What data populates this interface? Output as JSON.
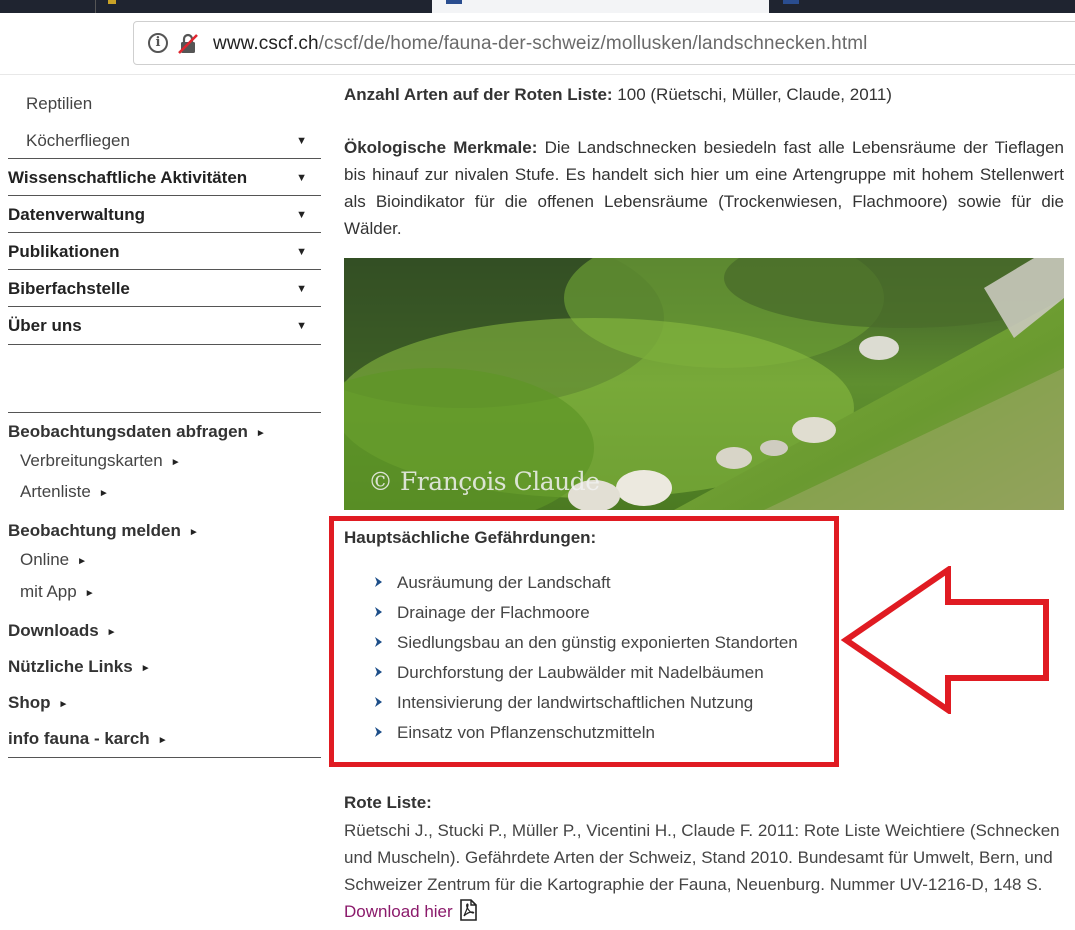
{
  "browser": {
    "url_host": "www.cscf.ch",
    "url_path": "/cscf/de/home/fauna-der-schweiz/mollusken/landschnecken.html"
  },
  "sidebar": {
    "sub_items": [
      {
        "label": "Reptilien"
      },
      {
        "label": "Köcherfliegen"
      }
    ],
    "main_items": [
      {
        "label": "Wissenschaftliche Aktivitäten"
      },
      {
        "label": "Datenverwaltung"
      },
      {
        "label": "Publikationen"
      },
      {
        "label": "Biberfachstelle"
      },
      {
        "label": "Über uns"
      }
    ],
    "caret_symbol": "▼",
    "links": [
      {
        "label": "Beobachtungsdaten abfragen"
      },
      {
        "label": "Verbreitungskarten"
      },
      {
        "label": "Artenliste"
      },
      {
        "label": "Beobachtung melden"
      },
      {
        "label": "Online"
      },
      {
        "label": "mit App"
      },
      {
        "label": "Downloads"
      },
      {
        "label": "Nützliche Links"
      },
      {
        "label": "Shop"
      },
      {
        "label": "info fauna - karch"
      }
    ],
    "arrow_symbol": "►"
  },
  "content": {
    "red_list_count_label": "Anzahl Arten auf der Roten Liste:",
    "red_list_count_value": "100 (Rüetschi, Müller, Claude, 2011)",
    "eco_label": "Ökologische Merkmale:",
    "eco_text": "Die Landschnecken besiedeln fast alle Lebensräume der Tieflagen bis hinauf zur nivalen Stufe. Es handelt sich hier um eine Artengruppe mit hohem Stellenwert als Bioindikator für die offenen Lebensräume (Trockenwiesen, Flachmoore) sowie für die Wälder.",
    "photo_credit": "© François Claude",
    "threats_title": "Hauptsächliche Gefährdungen:",
    "threats": [
      "Ausräumung der Landschaft",
      "Drainage der Flachmoore",
      "Siedlungsbau an den günstig exponierten Standorten",
      "Durchforstung der Laubwälder mit Nadelbäumen",
      "Intensivierung der landwirtschaftlichen Nutzung",
      "Einsatz von Pflanzenschutzmitteln"
    ],
    "rote_liste_title": "Rote Liste:",
    "rote_liste_text": "Rüetschi J., Stucki P., Müller P., Vicentini H., Claude F. 2011: Rote Liste Weichtiere (Schnecken und Muscheln). Gefährdete Arten der Schweiz, Stand 2010. Bundesamt für Umwelt, Bern, und Schweizer Zentrum für die Kartographie der Fauna, Neuenburg. Nummer UV-1216-D, 148 S.",
    "download_label": "Download hier"
  },
  "colors": {
    "highlight": "#e01b22",
    "link": "#8b1a6b",
    "bullet": "#1d4e89"
  }
}
